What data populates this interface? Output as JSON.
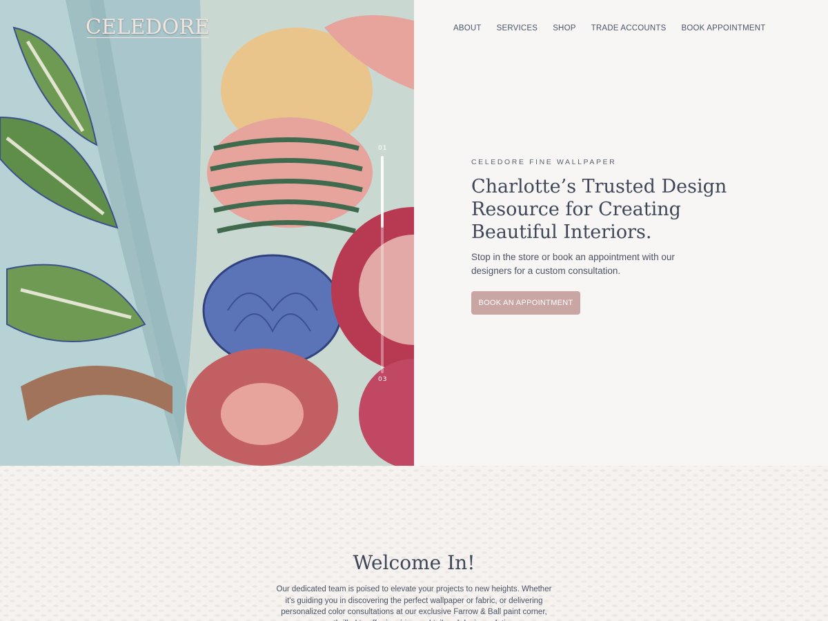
{
  "brand": {
    "logo_text": "CELEDORE"
  },
  "nav": {
    "items": [
      "ABOUT",
      "SERVICES",
      "SHOP",
      "TRADE ACCOUNTS",
      "BOOK APPOINTMENT"
    ]
  },
  "hero": {
    "slider": {
      "start_label": "01",
      "end_label": "03",
      "progress": 0.33
    },
    "eyebrow": "CELEDORE FINE WALLPAPER",
    "headline": "Charlotte’s Trusted Design Resource for Creating Beautiful Interiors.",
    "subtext": "Stop in the store or book an appointment with our designers for a custom consultation.",
    "cta_label": "BOOK AN APPOINTMENT"
  },
  "welcome": {
    "title": "Welcome In!",
    "body": "Our dedicated team is poised to elevate your projects to new heights. Whether it's guiding you in discovering the perfect wallpaper or fabric, or delivering personalized color consultations at our exclusive Farrow & Ball paint corner, we are thrilled to offer inspiring and tailored design solutions."
  },
  "colors": {
    "background": "#f8f6f4",
    "text": "#3d4758",
    "accent_button": "#c9a6a4",
    "hero_base": "#a9c8cc"
  }
}
